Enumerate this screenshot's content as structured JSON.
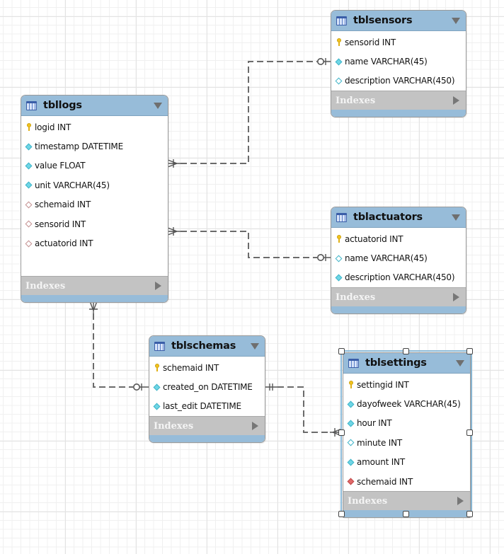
{
  "diagram": {
    "type": "EER model",
    "tables": [
      {
        "name": "tbllogs",
        "columns": [
          {
            "label": "logid INT",
            "icon": "primary-key-icon"
          },
          {
            "label": "timestamp DATETIME",
            "icon": "not-null-column-icon"
          },
          {
            "label": "value FLOAT",
            "icon": "not-null-column-icon"
          },
          {
            "label": "unit VARCHAR(45)",
            "icon": "not-null-column-icon"
          },
          {
            "label": "schemaid INT",
            "icon": "foreign-key-icon"
          },
          {
            "label": "sensorid INT",
            "icon": "foreign-key-icon"
          },
          {
            "label": "actuatorid INT",
            "icon": "foreign-key-icon"
          }
        ],
        "indexes_label": "Indexes"
      },
      {
        "name": "tblsensors",
        "columns": [
          {
            "label": "sensorid INT",
            "icon": "primary-key-icon"
          },
          {
            "label": "name VARCHAR(45)",
            "icon": "not-null-column-icon"
          },
          {
            "label": "description VARCHAR(450)",
            "icon": "nullable-column-icon"
          }
        ],
        "indexes_label": "Indexes"
      },
      {
        "name": "tblactuators",
        "columns": [
          {
            "label": "actuatorid INT",
            "icon": "primary-key-icon"
          },
          {
            "label": "name VARCHAR(45)",
            "icon": "nullable-column-icon"
          },
          {
            "label": "description VARCHAR(450)",
            "icon": "not-null-column-icon"
          }
        ],
        "indexes_label": "Indexes"
      },
      {
        "name": "tblschemas",
        "columns": [
          {
            "label": "schemaid INT",
            "icon": "primary-key-icon"
          },
          {
            "label": "created_on DATETIME",
            "icon": "not-null-column-icon"
          },
          {
            "label": "last_edit DATETIME",
            "icon": "not-null-column-icon"
          }
        ],
        "indexes_label": "Indexes"
      },
      {
        "name": "tblsettings",
        "selected": true,
        "columns": [
          {
            "label": "settingid INT",
            "icon": "primary-key-icon"
          },
          {
            "label": "dayofweek VARCHAR(45)",
            "icon": "not-null-column-icon"
          },
          {
            "label": "hour INT",
            "icon": "not-null-column-icon"
          },
          {
            "label": "minute INT",
            "icon": "nullable-column-icon"
          },
          {
            "label": "amount INT",
            "icon": "not-null-column-icon"
          },
          {
            "label": "schemaid INT",
            "icon": "not-null-foreign-key-icon"
          }
        ],
        "indexes_label": "Indexes"
      }
    ],
    "relationships": [
      {
        "from": "tbllogs",
        "to": "tblsensors",
        "from_cardinality": "one-or-many",
        "to_cardinality": "zero-or-one",
        "identifying": false
      },
      {
        "from": "tbllogs",
        "to": "tblactuators",
        "from_cardinality": "one-or-many",
        "to_cardinality": "zero-or-one",
        "identifying": false
      },
      {
        "from": "tbllogs",
        "to": "tblschemas",
        "from_cardinality": "one-or-many",
        "to_cardinality": "zero-or-one",
        "identifying": false
      },
      {
        "from": "tblschemas",
        "to": "tblsettings",
        "from_cardinality": "exactly-one",
        "to_cardinality": "one-or-many",
        "identifying": false
      }
    ]
  }
}
